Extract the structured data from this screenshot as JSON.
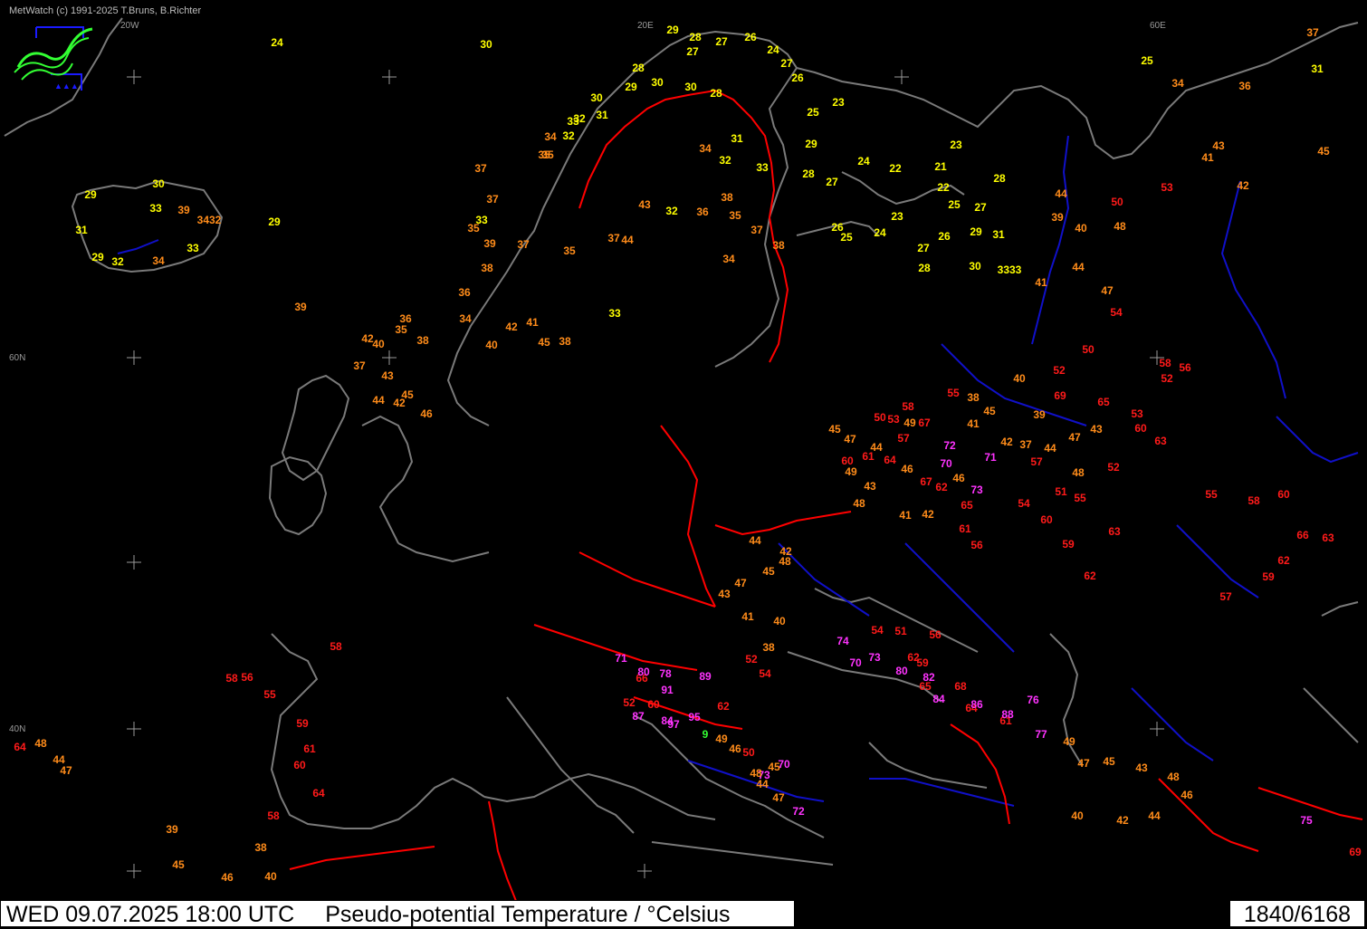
{
  "app": {
    "copyright": "MetWatch  (c) 1991-2025 T.Bruns, B.Richter",
    "logo_icon": "metwatch-fish-logo-icon"
  },
  "status_bar": {
    "datetime": "WED 09.07.2025 18:00 UTC",
    "parameter": "Pseudo-potential Temperature / °Celsius",
    "counter": "1840/6168"
  },
  "grid_labels": [
    {
      "label": "20W"
    },
    {
      "label": "20E"
    },
    {
      "label": "60E"
    },
    {
      "label": "60N"
    },
    {
      "label": "40N"
    }
  ],
  "color_scale": [
    {
      "max": 33,
      "color": "#ffff00"
    },
    {
      "max": 49,
      "color": "#ff8c1a"
    },
    {
      "max": 69,
      "color": "#ff1a1a"
    },
    {
      "max": 99,
      "color": "#ff33ff"
    }
  ],
  "colors": {
    "background": "#000000",
    "coastline": "#808080",
    "country_border": "#ff0000",
    "rivers": "#1010c8",
    "grid": "#9a9a9a",
    "status_background": "#ffffff",
    "status_text": "#000000",
    "special_green": "#33ff33"
  },
  "stations": [
    {
      "v": "24"
    },
    {
      "v": "30"
    },
    {
      "v": "29"
    },
    {
      "v": "28"
    },
    {
      "v": "27"
    },
    {
      "v": "26"
    },
    {
      "v": "24"
    },
    {
      "v": "27"
    },
    {
      "v": "26"
    },
    {
      "v": "28"
    },
    {
      "v": "29"
    },
    {
      "v": "30"
    },
    {
      "v": "27"
    },
    {
      "v": "30"
    },
    {
      "v": "28"
    },
    {
      "v": "25"
    },
    {
      "v": "34"
    },
    {
      "v": "37"
    },
    {
      "v": "31"
    },
    {
      "v": "36"
    },
    {
      "v": "43"
    },
    {
      "v": "41"
    },
    {
      "v": "45"
    },
    {
      "v": "53"
    },
    {
      "v": "42"
    },
    {
      "v": "50"
    },
    {
      "v": "48"
    },
    {
      "v": "40"
    },
    {
      "v": "39"
    },
    {
      "v": "44"
    },
    {
      "v": "30"
    },
    {
      "v": "31"
    },
    {
      "v": "32"
    },
    {
      "v": "33"
    },
    {
      "v": "32"
    },
    {
      "v": "35"
    },
    {
      "v": "34"
    },
    {
      "v": "34"
    },
    {
      "v": "31"
    },
    {
      "v": "32"
    },
    {
      "v": "33"
    },
    {
      "v": "29"
    },
    {
      "v": "27"
    },
    {
      "v": "28"
    },
    {
      "v": "23"
    },
    {
      "v": "25"
    },
    {
      "v": "24"
    },
    {
      "v": "22"
    },
    {
      "v": "23"
    },
    {
      "v": "21"
    },
    {
      "v": "28"
    },
    {
      "v": "22"
    },
    {
      "v": "25"
    },
    {
      "v": "27"
    },
    {
      "v": "26"
    },
    {
      "v": "25"
    },
    {
      "v": "24"
    },
    {
      "v": "23"
    },
    {
      "v": "27"
    },
    {
      "v": "26"
    },
    {
      "v": "29"
    },
    {
      "v": "31"
    },
    {
      "v": "28"
    },
    {
      "v": "30"
    },
    {
      "v": "3333"
    },
    {
      "v": "41"
    },
    {
      "v": "44"
    },
    {
      "v": "47"
    },
    {
      "v": "54"
    },
    {
      "v": "29"
    },
    {
      "v": "30"
    },
    {
      "v": "33"
    },
    {
      "v": "39"
    },
    {
      "v": "3432"
    },
    {
      "v": "31"
    },
    {
      "v": "32"
    },
    {
      "v": "33"
    },
    {
      "v": "34"
    },
    {
      "v": "29"
    },
    {
      "v": "29"
    },
    {
      "v": "37"
    },
    {
      "v": "35"
    },
    {
      "v": "37"
    },
    {
      "v": "33"
    },
    {
      "v": "35"
    },
    {
      "v": "39"
    },
    {
      "v": "37"
    },
    {
      "v": "36"
    },
    {
      "v": "38"
    },
    {
      "v": "35"
    },
    {
      "v": "44"
    },
    {
      "v": "37"
    },
    {
      "v": "43"
    },
    {
      "v": "32"
    },
    {
      "v": "36"
    },
    {
      "v": "38"
    },
    {
      "v": "35"
    },
    {
      "v": "37"
    },
    {
      "v": "38"
    },
    {
      "v": "34"
    },
    {
      "v": "33"
    },
    {
      "v": "36"
    },
    {
      "v": "35"
    },
    {
      "v": "38"
    },
    {
      "v": "34"
    },
    {
      "v": "40"
    },
    {
      "v": "42"
    },
    {
      "v": "41"
    },
    {
      "v": "45"
    },
    {
      "v": "38"
    },
    {
      "v": "39"
    },
    {
      "v": "42"
    },
    {
      "v": "37"
    },
    {
      "v": "40"
    },
    {
      "v": "43"
    },
    {
      "v": "45"
    },
    {
      "v": "44"
    },
    {
      "v": "42"
    },
    {
      "v": "46"
    },
    {
      "v": "50"
    },
    {
      "v": "52"
    },
    {
      "v": "56"
    },
    {
      "v": "58"
    },
    {
      "v": "53"
    },
    {
      "v": "60"
    },
    {
      "v": "63"
    },
    {
      "v": "65"
    },
    {
      "v": "69"
    },
    {
      "v": "52"
    },
    {
      "v": "55"
    },
    {
      "v": "38"
    },
    {
      "v": "40"
    },
    {
      "v": "45"
    },
    {
      "v": "41"
    },
    {
      "v": "39"
    },
    {
      "v": "42"
    },
    {
      "v": "37"
    },
    {
      "v": "44"
    },
    {
      "v": "47"
    },
    {
      "v": "43"
    },
    {
      "v": "48"
    },
    {
      "v": "52"
    },
    {
      "v": "55"
    },
    {
      "v": "51"
    },
    {
      "v": "57"
    },
    {
      "v": "60"
    },
    {
      "v": "59"
    },
    {
      "v": "63"
    },
    {
      "v": "62"
    },
    {
      "v": "58"
    },
    {
      "v": "67"
    },
    {
      "v": "72"
    },
    {
      "v": "70"
    },
    {
      "v": "71"
    },
    {
      "v": "73"
    },
    {
      "v": "65"
    },
    {
      "v": "61"
    },
    {
      "v": "56"
    },
    {
      "v": "54"
    },
    {
      "v": "45"
    },
    {
      "v": "47"
    },
    {
      "v": "44"
    },
    {
      "v": "49"
    },
    {
      "v": "46"
    },
    {
      "v": "43"
    },
    {
      "v": "48"
    },
    {
      "v": "41"
    },
    {
      "v": "42"
    },
    {
      "v": "50"
    },
    {
      "v": "53"
    },
    {
      "v": "49"
    },
    {
      "v": "57"
    },
    {
      "v": "61"
    },
    {
      "v": "60"
    },
    {
      "v": "64"
    },
    {
      "v": "67"
    },
    {
      "v": "62"
    },
    {
      "v": "46"
    },
    {
      "v": "44"
    },
    {
      "v": "42"
    },
    {
      "v": "48"
    },
    {
      "v": "45"
    },
    {
      "v": "47"
    },
    {
      "v": "43"
    },
    {
      "v": "41"
    },
    {
      "v": "40"
    },
    {
      "v": "38"
    },
    {
      "v": "52"
    },
    {
      "v": "54"
    },
    {
      "v": "51"
    },
    {
      "v": "56"
    },
    {
      "v": "59"
    },
    {
      "v": "62"
    },
    {
      "v": "65"
    },
    {
      "v": "68"
    },
    {
      "v": "64"
    },
    {
      "v": "61"
    },
    {
      "v": "77"
    },
    {
      "v": "74"
    },
    {
      "v": "70"
    },
    {
      "v": "73"
    },
    {
      "v": "80"
    },
    {
      "v": "82"
    },
    {
      "v": "84"
    },
    {
      "v": "86"
    },
    {
      "v": "88"
    },
    {
      "v": "76"
    },
    {
      "v": "49"
    },
    {
      "v": "47"
    },
    {
      "v": "45"
    },
    {
      "v": "43"
    },
    {
      "v": "48"
    },
    {
      "v": "46"
    },
    {
      "v": "44"
    },
    {
      "v": "42"
    },
    {
      "v": "40"
    },
    {
      "v": "55"
    },
    {
      "v": "58"
    },
    {
      "v": "60"
    },
    {
      "v": "63"
    },
    {
      "v": "66"
    },
    {
      "v": "62"
    },
    {
      "v": "59"
    },
    {
      "v": "57"
    },
    {
      "v": "64"
    },
    {
      "v": "48"
    },
    {
      "v": "44"
    },
    {
      "v": "47"
    },
    {
      "v": "39"
    },
    {
      "v": "45"
    },
    {
      "v": "46"
    },
    {
      "v": "40"
    },
    {
      "v": "38"
    },
    {
      "v": "58"
    },
    {
      "v": "58"
    },
    {
      "v": "58"
    },
    {
      "v": "56"
    },
    {
      "v": "55"
    },
    {
      "v": "59"
    },
    {
      "v": "61"
    },
    {
      "v": "60"
    },
    {
      "v": "64"
    },
    {
      "v": "66"
    },
    {
      "v": "52"
    },
    {
      "v": "60"
    },
    {
      "v": "54"
    },
    {
      "v": "62"
    },
    {
      "v": "70"
    },
    {
      "v": "73"
    },
    {
      "v": "72"
    },
    {
      "v": "69"
    },
    {
      "v": "75"
    },
    {
      "v": "71"
    },
    {
      "v": "80"
    },
    {
      "v": "78"
    },
    {
      "v": "89"
    },
    {
      "v": "91"
    },
    {
      "v": "97"
    },
    {
      "v": "84"
    },
    {
      "v": "87"
    },
    {
      "v": "95"
    },
    {
      "v": "9"
    },
    {
      "v": "49"
    },
    {
      "v": "46"
    },
    {
      "v": "50"
    },
    {
      "v": "45"
    },
    {
      "v": "48"
    },
    {
      "v": "44"
    },
    {
      "v": "47"
    },
    {
      "v": "51"
    },
    {
      "v": "53"
    },
    {
      "v": "57"
    },
    {
      "v": "55"
    },
    {
      "v": "59"
    },
    {
      "v": "62"
    },
    {
      "v": "60"
    },
    {
      "v": "65"
    },
    {
      "v": "67"
    }
  ]
}
